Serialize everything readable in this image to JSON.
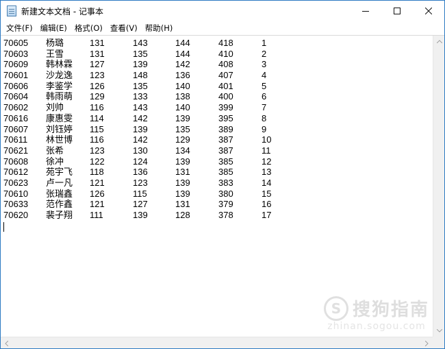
{
  "window": {
    "title": "新建文本文档 - 记事本"
  },
  "menu": [
    "文件(F)",
    "编辑(E)",
    "格式(O)",
    "查看(V)",
    "帮助(H)"
  ],
  "rows": [
    [
      "70605",
      "杨璐",
      "131",
      "143",
      "144",
      "418",
      "1"
    ],
    [
      "70603",
      "王雪",
      "131",
      "135",
      "144",
      "410",
      "2"
    ],
    [
      "70609",
      "韩林霖",
      "127",
      "139",
      "142",
      "408",
      "3"
    ],
    [
      "70601",
      "沙龙逸",
      "123",
      "148",
      "136",
      "407",
      "4"
    ],
    [
      "70606",
      "李鉴学",
      "126",
      "135",
      "140",
      "401",
      "5"
    ],
    [
      "70604",
      "韩雨萌",
      "129",
      "133",
      "138",
      "400",
      "6"
    ],
    [
      "70602",
      "刘帅",
      "116",
      "143",
      "140",
      "399",
      "7"
    ],
    [
      "70616",
      "康惠雯",
      "114",
      "142",
      "139",
      "395",
      "8"
    ],
    [
      "70607",
      "刘钰婷",
      "115",
      "139",
      "135",
      "389",
      "9"
    ],
    [
      "70611",
      "林世博",
      "116",
      "142",
      "129",
      "387",
      "10"
    ],
    [
      "70621",
      "张希",
      "123",
      "130",
      "134",
      "387",
      "11"
    ],
    [
      "70608",
      "徐冲",
      "122",
      "124",
      "139",
      "385",
      "12"
    ],
    [
      "70612",
      "苑宇飞",
      "118",
      "136",
      "131",
      "385",
      "13"
    ],
    [
      "70623",
      "卢一凡",
      "121",
      "123",
      "139",
      "383",
      "14"
    ],
    [
      "70610",
      "张瑞鑫",
      "126",
      "115",
      "139",
      "380",
      "15"
    ],
    [
      "70633",
      "范作鑫",
      "121",
      "127",
      "131",
      "379",
      "16"
    ],
    [
      "70620",
      "裴子翔",
      "111",
      "139",
      "128",
      "378",
      "17"
    ]
  ],
  "watermark": {
    "name": "搜狗指南",
    "url": "zhinan.sogou.com",
    "logo_letter": "S"
  },
  "icons": {
    "app": "notepad-icon",
    "minimize": "minimize-icon",
    "maximize": "maximize-icon",
    "close": "close-icon"
  }
}
